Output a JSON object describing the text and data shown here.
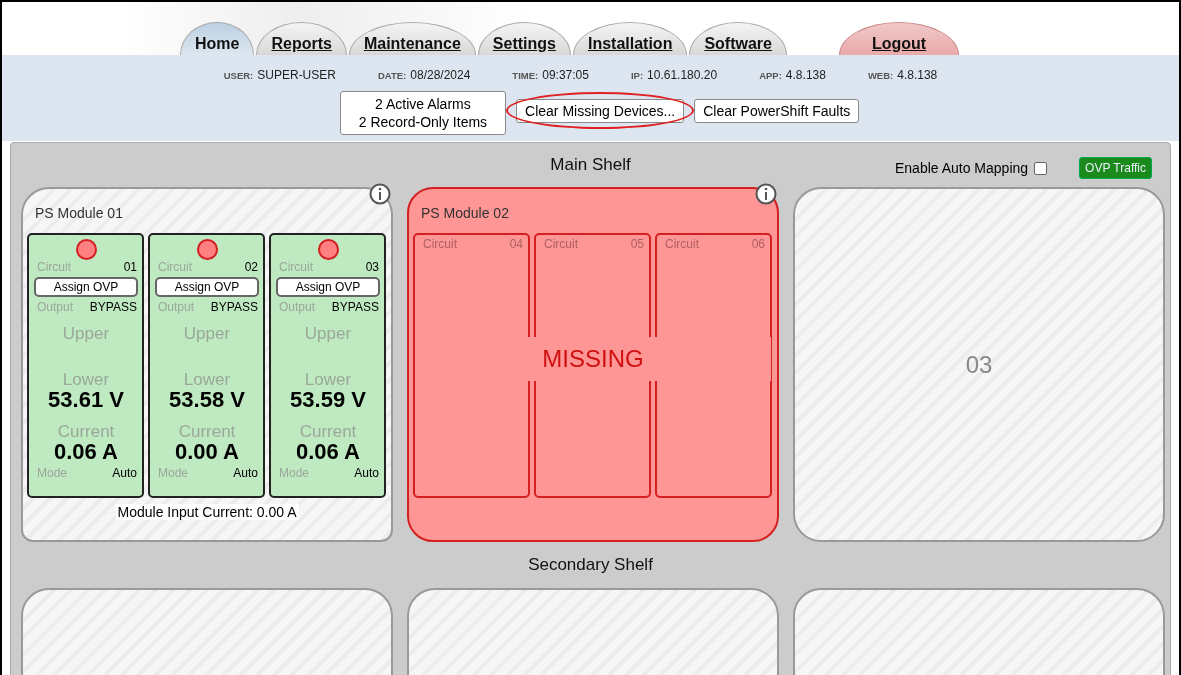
{
  "tabs": [
    {
      "label": "Home",
      "selected": true,
      "kind": "nav"
    },
    {
      "label": "Reports",
      "selected": false,
      "kind": "nav"
    },
    {
      "label": "Maintenance",
      "selected": false,
      "kind": "nav"
    },
    {
      "label": "Settings",
      "selected": false,
      "kind": "nav"
    },
    {
      "label": "Installation",
      "selected": false,
      "kind": "nav"
    },
    {
      "label": "Software",
      "selected": false,
      "kind": "nav"
    },
    {
      "label": "Logout",
      "selected": false,
      "kind": "logout"
    }
  ],
  "status": [
    {
      "label": "USER:",
      "value": "SUPER-USER"
    },
    {
      "label": "DATE:",
      "value": "08/28/2024"
    },
    {
      "label": "TIME:",
      "value": "09:37:05"
    },
    {
      "label": "IP:",
      "value": "10.61.180.20"
    },
    {
      "label": "APP:",
      "value": "4.8.138"
    },
    {
      "label": "WEB:",
      "value": "4.8.138"
    }
  ],
  "actions": [
    {
      "lines": [
        "2 Active Alarms",
        "2 Record-Only Items"
      ],
      "highlighted": false
    },
    {
      "lines": [
        "Clear Missing Devices..."
      ],
      "highlighted": true
    },
    {
      "lines": [
        "Clear PowerShift Faults"
      ],
      "highlighted": false
    }
  ],
  "main_shelf": {
    "title": "Main Shelf",
    "auto_mapping": {
      "label": "Enable Auto Mapping",
      "checked": false
    },
    "ovp_button": "OVP Traffic",
    "modules": [
      {
        "kind": "present",
        "title": "PS Module 01",
        "input_current": "Module Input Current: 0.00 A",
        "circuits": [
          {
            "alarm": true,
            "circuit_label": "Circuit",
            "number": "01",
            "assign": "Assign OVP",
            "output_label": "Output",
            "output": "BYPASS",
            "upper_label": "Upper",
            "lower_label": "Lower",
            "voltage": "53.61 V",
            "current_label": "Current",
            "current": "0.06 A",
            "mode_label": "Mode",
            "mode": "Auto"
          },
          {
            "alarm": true,
            "circuit_label": "Circuit",
            "number": "02",
            "assign": "Assign OVP",
            "output_label": "Output",
            "output": "BYPASS",
            "upper_label": "Upper",
            "lower_label": "Lower",
            "voltage": "53.58 V",
            "current_label": "Current",
            "current": "0.00 A",
            "mode_label": "Mode",
            "mode": "Auto"
          },
          {
            "alarm": true,
            "circuit_label": "Circuit",
            "number": "03",
            "assign": "Assign OVP",
            "output_label": "Output",
            "output": "BYPASS",
            "upper_label": "Upper",
            "lower_label": "Lower",
            "voltage": "53.59 V",
            "current_label": "Current",
            "current": "0.06 A",
            "mode_label": "Mode",
            "mode": "Auto"
          }
        ]
      },
      {
        "kind": "missing",
        "title": "PS Module 02",
        "status": "MISSING",
        "circuits": [
          {
            "circuit_label": "Circuit",
            "number": "04"
          },
          {
            "circuit_label": "Circuit",
            "number": "05"
          },
          {
            "circuit_label": "Circuit",
            "number": "06"
          }
        ]
      },
      {
        "kind": "empty",
        "slot": "03"
      }
    ]
  },
  "secondary_shelf": {
    "title": "Secondary Shelf",
    "modules": [
      {
        "kind": "empty"
      },
      {
        "kind": "empty"
      },
      {
        "kind": "empty"
      }
    ]
  }
}
